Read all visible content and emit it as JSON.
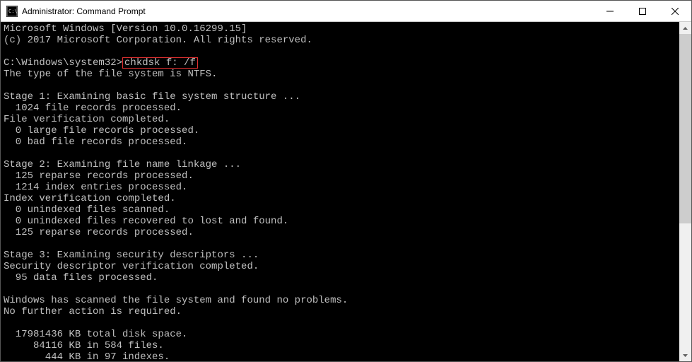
{
  "window": {
    "title": "Administrator: Command Prompt"
  },
  "terminal": {
    "prompt_prefix": "C:\\Windows\\system32>",
    "command": "chkdsk f: /f",
    "lines": [
      "Microsoft Windows [Version 10.0.16299.15]",
      "(c) 2017 Microsoft Corporation. All rights reserved.",
      "",
      "__PROMPT__",
      "The type of the file system is NTFS.",
      "",
      "Stage 1: Examining basic file system structure ...",
      "  1024 file records processed.",
      "File verification completed.",
      "  0 large file records processed.",
      "  0 bad file records processed.",
      "",
      "Stage 2: Examining file name linkage ...",
      "  125 reparse records processed.",
      "  1214 index entries processed.",
      "Index verification completed.",
      "  0 unindexed files scanned.",
      "  0 unindexed files recovered to lost and found.",
      "  125 reparse records processed.",
      "",
      "Stage 3: Examining security descriptors ...",
      "Security descriptor verification completed.",
      "  95 data files processed.",
      "",
      "Windows has scanned the file system and found no problems.",
      "No further action is required.",
      "",
      "  17981436 KB total disk space.",
      "     84116 KB in 584 files.",
      "       444 KB in 97 indexes."
    ]
  }
}
